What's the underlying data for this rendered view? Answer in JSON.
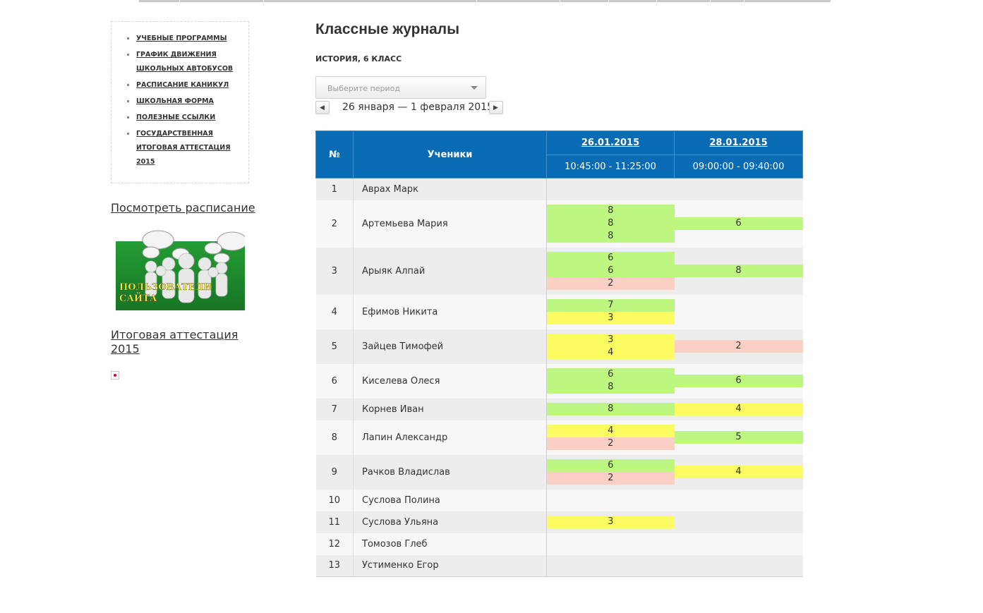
{
  "sidebar": {
    "menu": [
      "Учебные программы",
      "График движения школьных автобусов",
      "Расписание каникул",
      "Школьная форма",
      "Полезные ссылки",
      "Государственная итоговая аттестация 2015"
    ],
    "schedule_link": "Посмотреть расписание",
    "banner_text": "ПОЛЬЗОВАТЕЛИ САЙТА",
    "attestation_link": "Итоговая аттестация 2015"
  },
  "main": {
    "title": "Классные журналы",
    "subject": "ИСТОРИЯ, 6 КЛАСС",
    "period_placeholder": "Выберите период",
    "period_text": "26 января — 1 февраля 2015"
  },
  "table": {
    "col_num": "№",
    "col_students": "Ученики",
    "lessons": [
      {
        "date": "26.01.2015",
        "time": "10:45:00 - 11:25:00"
      },
      {
        "date": "28.01.2015",
        "time": "09:00:00 - 09:40:00"
      }
    ],
    "rows": [
      {
        "num": "1",
        "name": "Аврах Марк",
        "grades": [
          [],
          []
        ]
      },
      {
        "num": "2",
        "name": "Артемьева Мария",
        "grades": [
          [
            "8",
            "8",
            "8"
          ],
          [
            "6"
          ]
        ]
      },
      {
        "num": "3",
        "name": "Арыяк Алпай",
        "grades": [
          [
            "6",
            "6",
            "2"
          ],
          [
            "8"
          ]
        ]
      },
      {
        "num": "4",
        "name": "Ефимов Никита",
        "grades": [
          [
            "7",
            "3"
          ],
          []
        ]
      },
      {
        "num": "5",
        "name": "Зайцев Тимофей",
        "grades": [
          [
            "3",
            "4"
          ],
          [
            "2"
          ]
        ]
      },
      {
        "num": "6",
        "name": "Киселева Олеся",
        "grades": [
          [
            "6",
            "8"
          ],
          [
            "6"
          ]
        ]
      },
      {
        "num": "7",
        "name": "Корнев Иван",
        "grades": [
          [
            "8"
          ],
          [
            "4"
          ]
        ]
      },
      {
        "num": "8",
        "name": "Лапин Александр",
        "grades": [
          [
            "4",
            "2"
          ],
          [
            "5"
          ]
        ]
      },
      {
        "num": "9",
        "name": "Рачков Владислав",
        "grades": [
          [
            "6",
            "2"
          ],
          [
            "4"
          ]
        ]
      },
      {
        "num": "10",
        "name": "Суслова Полина",
        "grades": [
          [],
          []
        ]
      },
      {
        "num": "11",
        "name": "Суслова Ульяна",
        "grades": [
          [
            "3"
          ],
          []
        ]
      },
      {
        "num": "12",
        "name": "Томозов Глеб",
        "grades": [
          [],
          []
        ]
      },
      {
        "num": "13",
        "name": "Устименко Егор",
        "grades": [
          [],
          []
        ]
      }
    ]
  },
  "colors": {
    "header_blue": "#0a6bb5",
    "grade_high": "#bdf77f",
    "grade_mid": "#fbfb62",
    "grade_low": "#fbcfc4"
  }
}
